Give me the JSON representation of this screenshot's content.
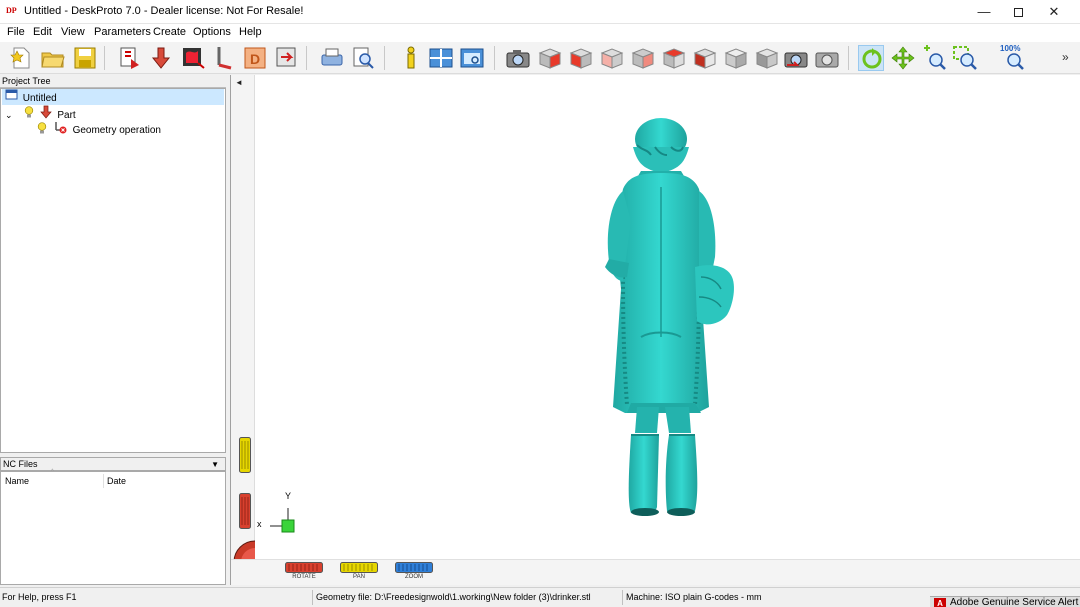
{
  "window": {
    "title": "Untitled - DeskProto 7.0 - Dealer license: Not For Resale!",
    "app_icon": "DP",
    "minimize": "—",
    "close": "✕"
  },
  "menu": [
    "File",
    "Edit",
    "View",
    "Parameters",
    "Create",
    "Options",
    "Help"
  ],
  "toolbar": {
    "buttons": [
      "new-icon",
      "open-icon",
      "save-icon",
      "import-geometry-icon",
      "part-icon",
      "wizard-icon",
      "toolpath-icon",
      "drawing-icon",
      "export-icon",
      "print-icon",
      "preview-icon",
      "info-icon",
      "layout-icon",
      "window-icon",
      "camera-icon",
      "view-front-icon",
      "view-back-icon",
      "view-left-icon",
      "view-right-icon",
      "view-top-icon",
      "view-bottom-icon",
      "view-iso-icon",
      "view-iso2-icon",
      "camera-undo-icon",
      "camera-redo-icon",
      "rotate-tool-icon",
      "pan-tool-icon",
      "zoom-tool-icon",
      "zoom-window-icon",
      "zoom-100-icon"
    ],
    "zoom_label": "100%",
    "more": "»"
  },
  "project_tree": {
    "header": "Project Tree",
    "items": [
      {
        "label": "Untitled",
        "level": 0,
        "selected": true
      },
      {
        "label": "Part",
        "level": 1,
        "expanded": true
      },
      {
        "label": "Geometry operation",
        "level": 2
      }
    ]
  },
  "nc_files": {
    "header": "NC Files",
    "columns": [
      "Name",
      "Date"
    ]
  },
  "viewport": {
    "model_color": "#2fd0c8",
    "axis_y": "Y",
    "axis_x": "x",
    "dials": [
      {
        "label": "ROTATE",
        "color": "#c0392b"
      },
      {
        "label": "PAN",
        "color": "#d4c200"
      },
      {
        "label": "ZOOM",
        "color": "#2f7fd8"
      }
    ],
    "collapse_arrow": "◄"
  },
  "status": {
    "help": "For Help, press F1",
    "geometry_file": "Geometry file: D:\\Freedesignwold\\1.working\\New folder (3)\\drinker.stl",
    "machine": "Machine: ISO plain G-codes - mm",
    "adobe_alert": "Adobe Genuine Service Alert",
    "adobe_icon": "A"
  }
}
